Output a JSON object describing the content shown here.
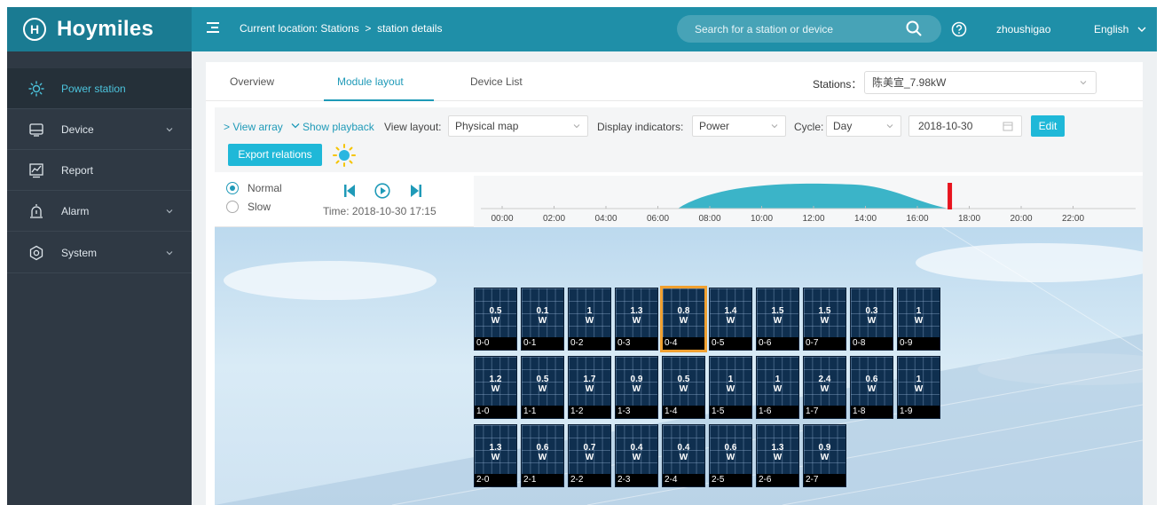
{
  "header": {
    "logo_mark": "H",
    "brand": "Hoymiles",
    "breadcrumb": "Current location: Stations  >  station details",
    "search_placeholder": "Search for a station or device",
    "username": "zhoushigao",
    "language": "English"
  },
  "sidebar": {
    "items": [
      {
        "label": "Power station",
        "icon": "sun-icon",
        "active": true
      },
      {
        "label": "Device",
        "icon": "device-icon",
        "expandable": true
      },
      {
        "label": "Report",
        "icon": "report-icon"
      },
      {
        "label": "Alarm",
        "icon": "alarm-icon",
        "expandable": true
      },
      {
        "label": "System",
        "icon": "settings-icon",
        "expandable": true
      }
    ]
  },
  "tabs": {
    "overview": "Overview",
    "module_layout": "Module layout",
    "device_list": "Device List",
    "active": "Module layout"
  },
  "stations": {
    "label": "Stations：",
    "value": "陈美宣_7.98kW"
  },
  "toolbar": {
    "view_array": "> View array",
    "show_playback": "Show playback",
    "view_layout_label": "View layout:",
    "view_layout_value": "Physical map",
    "display_indicators_label": "Display indicators:",
    "display_indicators_value": "Power",
    "cycle_label": "Cycle:",
    "cycle_value": "Day",
    "date_value": "2018-10-30",
    "edit_label": "Edit",
    "export_label": "Export relations"
  },
  "playback": {
    "normal_label": "Normal",
    "slow_label": "Slow",
    "mode": "Normal",
    "time_label": "Time: 2018-10-30 17:15",
    "ticks": [
      "00:00",
      "02:00",
      "04:00",
      "06:00",
      "08:00",
      "10:00",
      "12:00",
      "14:00",
      "16:00",
      "18:00",
      "20:00",
      "22:00"
    ],
    "current_hour": 17.25
  },
  "modules": {
    "unit": "W",
    "selected": "0-4",
    "rows": [
      [
        {
          "id": "0-0",
          "power": "0.5"
        },
        {
          "id": "0-1",
          "power": "0.1"
        },
        {
          "id": "0-2",
          "power": "1"
        },
        {
          "id": "0-3",
          "power": "1.3"
        },
        {
          "id": "0-4",
          "power": "0.8"
        },
        {
          "id": "0-5",
          "power": "1.4"
        },
        {
          "id": "0-6",
          "power": "1.5"
        },
        {
          "id": "0-7",
          "power": "1.5"
        },
        {
          "id": "0-8",
          "power": "0.3"
        },
        {
          "id": "0-9",
          "power": "1"
        }
      ],
      [
        {
          "id": "1-0",
          "power": "1.2"
        },
        {
          "id": "1-1",
          "power": "0.5"
        },
        {
          "id": "1-2",
          "power": "1.7"
        },
        {
          "id": "1-3",
          "power": "0.9"
        },
        {
          "id": "1-4",
          "power": "0.5"
        },
        {
          "id": "1-5",
          "power": "1"
        },
        {
          "id": "1-6",
          "power": "1"
        },
        {
          "id": "1-7",
          "power": "2.4"
        },
        {
          "id": "1-8",
          "power": "0.6"
        },
        {
          "id": "1-9",
          "power": "1"
        }
      ],
      [
        {
          "id": "2-0",
          "power": "1.3"
        },
        {
          "id": "2-1",
          "power": "0.6"
        },
        {
          "id": "2-2",
          "power": "0.7"
        },
        {
          "id": "2-3",
          "power": "0.4"
        },
        {
          "id": "2-4",
          "power": "0.4"
        },
        {
          "id": "2-5",
          "power": "0.6"
        },
        {
          "id": "2-6",
          "power": "1.3"
        },
        {
          "id": "2-7",
          "power": "0.9"
        }
      ]
    ]
  }
}
